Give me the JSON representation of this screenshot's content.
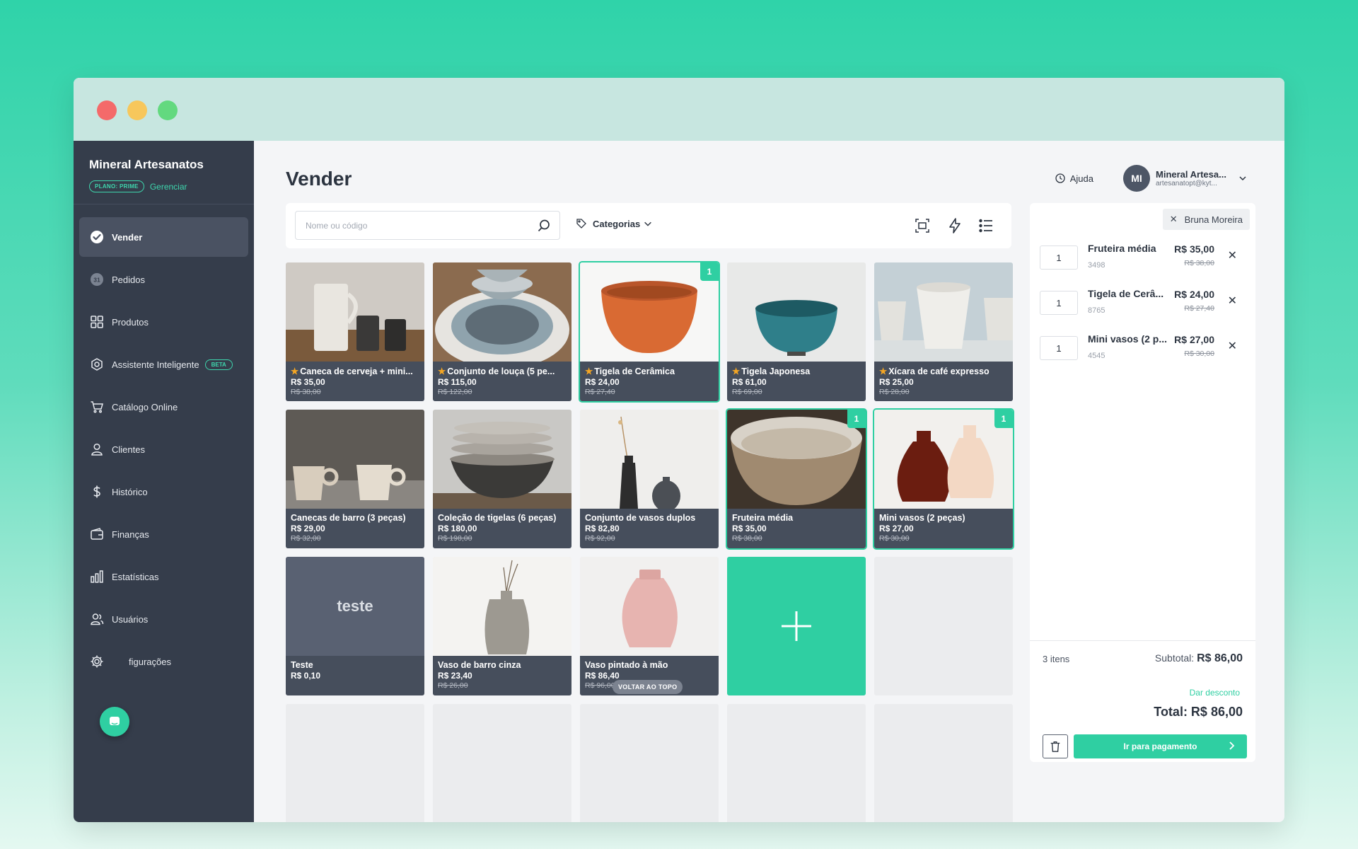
{
  "window": {
    "controls": [
      "close",
      "minimize",
      "maximize"
    ]
  },
  "sidebar": {
    "brand": "Mineral Artesanatos",
    "plan_badge": "PLANO: PRIME",
    "manage_label": "Gerenciar",
    "items": [
      {
        "label": "Vender",
        "icon": "check-circle-icon",
        "active": true
      },
      {
        "label": "Pedidos",
        "icon": "orders-count-icon",
        "badge": "31"
      },
      {
        "label": "Produtos",
        "icon": "grid-icon"
      },
      {
        "label": "Assistente Inteligente",
        "icon": "robot-icon",
        "badge": "BETA"
      },
      {
        "label": "Catálogo Online",
        "icon": "cart-icon"
      },
      {
        "label": "Clientes",
        "icon": "user-icon"
      },
      {
        "label": "Histórico",
        "icon": "dollar-icon"
      },
      {
        "label": "Finanças",
        "icon": "wallet-icon"
      },
      {
        "label": "Estatísticas",
        "icon": "bar-chart-icon"
      },
      {
        "label": "Usuários",
        "icon": "users-icon"
      },
      {
        "label": "figurações",
        "icon": "gear-icon"
      }
    ]
  },
  "header": {
    "title": "Vender",
    "help_label": "Ajuda",
    "user": {
      "initials": "MI",
      "name": "Mineral Artesa...",
      "email": "artesanatopt@kyt..."
    }
  },
  "toolbar": {
    "search_placeholder": "Nome ou código",
    "categories_label": "Categorias"
  },
  "products": [
    {
      "name": "Caneca de cerveja + mini...",
      "price": "R$ 35,00",
      "old_price": "R$ 38,00",
      "starred": true,
      "qty": null,
      "photo": "mugs"
    },
    {
      "name": "Conjunto de louça (5 pe...",
      "price": "R$ 115,00",
      "old_price": "R$ 122,00",
      "starred": true,
      "qty": null,
      "photo": "plates"
    },
    {
      "name": "Tigela de Cerâmica",
      "price": "R$ 24,00",
      "old_price": "R$ 27,40",
      "starred": true,
      "qty": "1",
      "photo": "orange-bowl"
    },
    {
      "name": "Tigela Japonesa",
      "price": "R$ 61,00",
      "old_price": "R$ 69,00",
      "starred": true,
      "qty": null,
      "photo": "teal-bowl"
    },
    {
      "name": "Xícara de café expresso",
      "price": "R$ 25,00",
      "old_price": "R$ 28,00",
      "starred": true,
      "qty": null,
      "photo": "cups"
    },
    {
      "name": "Canecas de barro (3 peças)",
      "price": "R$ 29,00",
      "old_price": "R$ 32,00",
      "starred": false,
      "qty": null,
      "photo": "clay-mugs"
    },
    {
      "name": "Coleção de tigelas (6 peças)",
      "price": "R$ 180,00",
      "old_price": "R$ 198,00",
      "starred": false,
      "qty": null,
      "photo": "stacked-bowls"
    },
    {
      "name": "Conjunto de vasos duplos",
      "price": "R$ 82,80",
      "old_price": "R$ 92,00",
      "starred": false,
      "qty": null,
      "photo": "dark-vases"
    },
    {
      "name": "Fruteira média",
      "price": "R$ 35,00",
      "old_price": "R$ 38,00",
      "starred": false,
      "qty": "1",
      "photo": "fruit-bowl"
    },
    {
      "name": "Mini vasos (2 peças)",
      "price": "R$ 27,00",
      "old_price": "R$ 30,00",
      "starred": false,
      "qty": "1",
      "photo": "mini-vases"
    },
    {
      "name": "Teste",
      "price": "R$ 0,10",
      "old_price": "",
      "starred": false,
      "qty": null,
      "tile_text": "teste"
    },
    {
      "name": "Vaso de barro cinza",
      "price": "R$ 23,40",
      "old_price": "R$ 26,00",
      "starred": false,
      "qty": null,
      "photo": "grey-vase"
    },
    {
      "name": "Vaso pintado à mão",
      "price": "R$ 86,40",
      "old_price": "R$ 96,00",
      "starred": false,
      "qty": null,
      "photo": "pink-vase"
    }
  ],
  "back_to_top_label": "VOLTAR AO TOPO",
  "cart": {
    "customer": "Bruna Moreira",
    "items": [
      {
        "qty": "1",
        "name": "Fruteira média",
        "code": "3498",
        "price": "R$ 35,00",
        "old_price": "R$ 38,00"
      },
      {
        "qty": "1",
        "name": "Tigela de Cerâ...",
        "code": "8765",
        "price": "R$ 24,00",
        "old_price": "R$ 27,40"
      },
      {
        "qty": "1",
        "name": "Mini vasos (2 p...",
        "code": "4545",
        "price": "R$ 27,00",
        "old_price": "R$ 30,00"
      }
    ],
    "count_label": "3 itens",
    "subtotal_label": "Subtotal:",
    "subtotal_value": "R$ 86,00",
    "discount_label": "Dar desconto",
    "total_label": "Total: R$ 86,00",
    "pay_label": "Ir para pagamento"
  },
  "colors": {
    "accent": "#2fcfa2",
    "sidebar": "#353d4b",
    "card_info": "#464e5c"
  }
}
